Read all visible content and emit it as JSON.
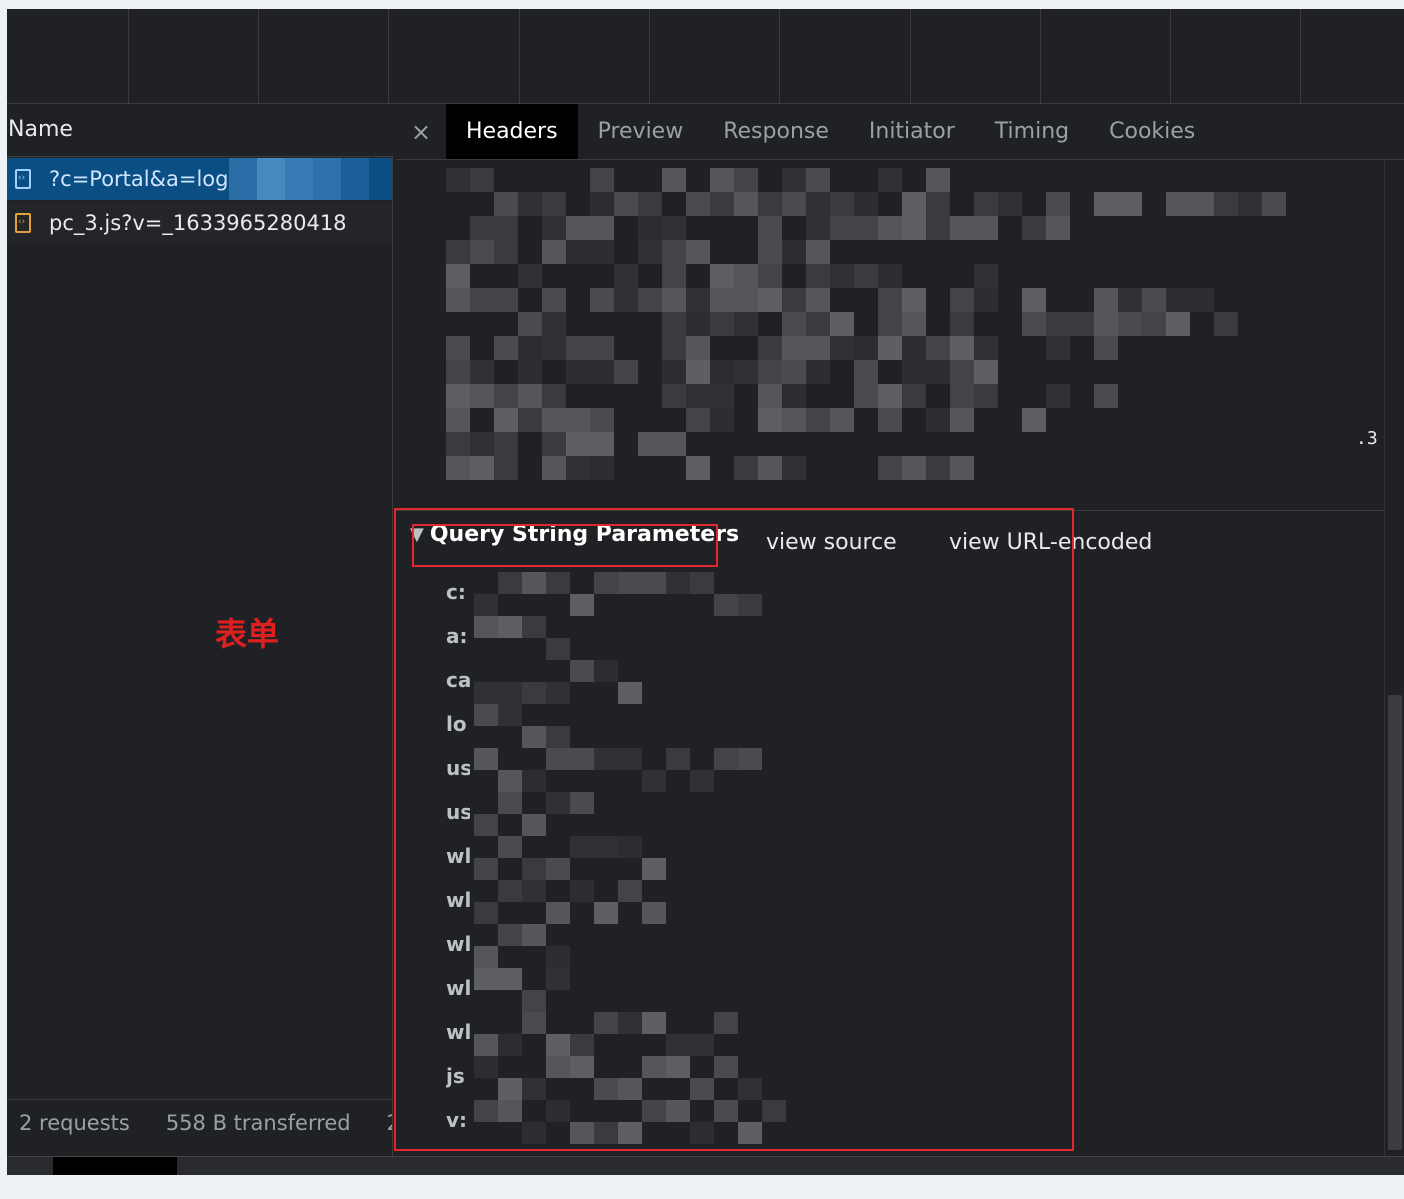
{
  "network": {
    "name_column": "Name",
    "requests": [
      {
        "name": "?c=Portal&a=log",
        "selected": true
      },
      {
        "name": "pc_3.js?v=_1633965280418",
        "selected": false
      }
    ],
    "status": {
      "requests": "2 requests",
      "transferred": "558 B transferred",
      "more": "2"
    }
  },
  "annotation": "表单",
  "detail": {
    "close_icon": "close-icon",
    "close_glyph": "×",
    "tabs": [
      {
        "label": "Headers",
        "active": true
      },
      {
        "label": "Preview",
        "active": false
      },
      {
        "label": "Response",
        "active": false
      },
      {
        "label": "Initiator",
        "active": false
      },
      {
        "label": "Timing",
        "active": false
      },
      {
        "label": "Cookies",
        "active": false
      }
    ],
    "headers_partial_text": ".3",
    "query_string": {
      "title": "Query String Parameters",
      "toggle_glyph": "▼",
      "view_source": "view source",
      "view_url_encoded": "view URL-encoded",
      "param_keys": [
        "c:",
        "a:",
        "ca",
        "lo",
        "us",
        "us",
        "wl",
        "wl",
        "wl",
        "wl",
        "wl",
        "js",
        "v:"
      ]
    }
  },
  "colors": {
    "background": "#202124",
    "selected_row": "#0b4e83",
    "annotation_red": "#e02020",
    "highlight_box": "#e0282e"
  }
}
